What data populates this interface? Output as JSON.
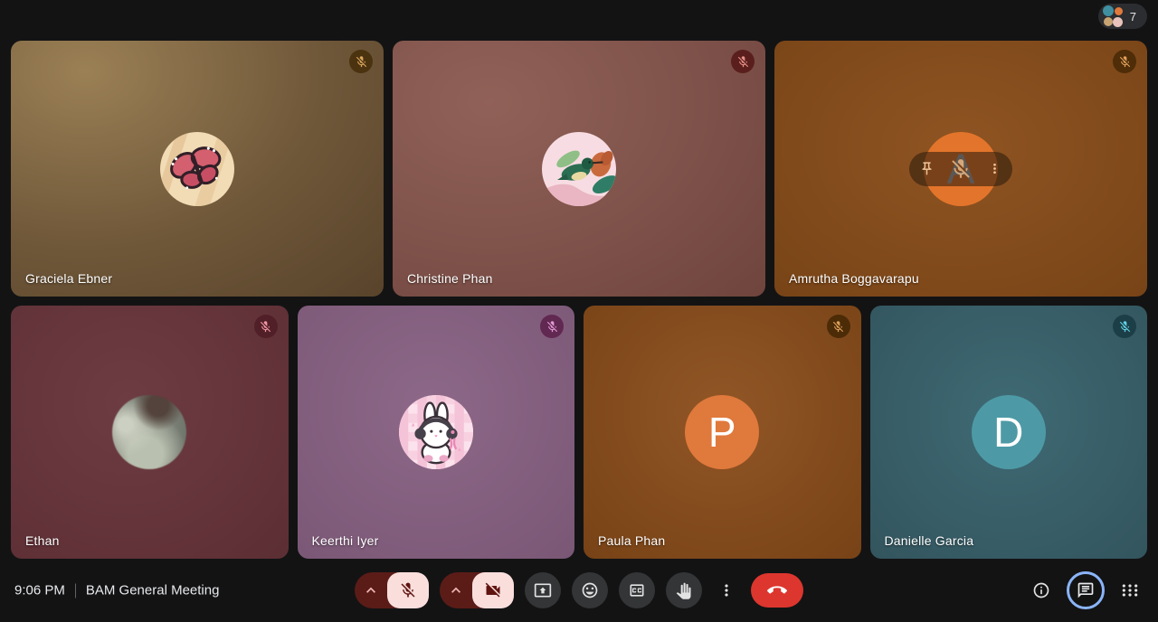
{
  "people_pill": {
    "count": "7"
  },
  "meeting": {
    "time": "9:06 PM",
    "name": "BAM General Meeting"
  },
  "participants": [
    {
      "name": "Graciela Ebner",
      "avatar": "butterfly-image",
      "avatar_bg": "#f2dcb6",
      "tile_colors": [
        "#9b8055",
        "#6f5739",
        "#58432b"
      ],
      "tile_light": "20% 12%",
      "badge_bg": "#4b3310",
      "badge_icon": "#dca75f",
      "mic": "muted"
    },
    {
      "name": "Christine Phan",
      "avatar": "hummingbird-image",
      "avatar_bg": "#f7dde3",
      "tile_colors": [
        "#906158",
        "#7c5048",
        "#6a4038"
      ],
      "tile_light": "26% 24%",
      "badge_bg": "#5a1f1c",
      "badge_icon": "#ea9089",
      "mic": "muted"
    },
    {
      "name": "Amrutha Boggavarapu",
      "avatar": "letter",
      "avatar_letter": "A",
      "avatar_letter_color": "#98abbd",
      "avatar_bg": "#e2752b",
      "tile_colors": [
        "#8f5422",
        "#7b4618",
        "#693a11"
      ],
      "tile_light": "50% 42%",
      "badge_bg": "#4e2d08",
      "badge_icon": "#e2a35e",
      "mic": "muted",
      "hover_controls": true
    },
    {
      "name": "Ethan",
      "avatar": "photo",
      "tile_colors": [
        "#6d3c42",
        "#603137",
        "#532a30"
      ],
      "tile_light": "42% 38%",
      "badge_bg": "#511f28",
      "badge_icon": "#ef97a3",
      "mic": "muted"
    },
    {
      "name": "Keerthi Iyer",
      "avatar": "bunny-image",
      "avatar_bg": "#fbe2ec",
      "tile_colors": [
        "#8d6888",
        "#7e5a79",
        "#6d4c69"
      ],
      "tile_light": "48% 40%",
      "badge_bg": "#612852",
      "badge_icon": "#e39ad5",
      "mic": "muted"
    },
    {
      "name": "Paula Phan",
      "avatar": "letter",
      "avatar_letter": "P",
      "avatar_letter_color": "#ffffff",
      "avatar_bg": "#e0793c",
      "tile_colors": [
        "#915626",
        "#7b4518",
        "#643610"
      ],
      "tile_light": "50% 42%",
      "badge_bg": "#4c2b07",
      "badge_icon": "#dda15a",
      "mic": "muted"
    },
    {
      "name": "Danielle Garcia",
      "avatar": "letter",
      "avatar_letter": "D",
      "avatar_letter_color": "#ffffff",
      "avatar_bg": "#4d9aa6",
      "tile_colors": [
        "#3f6a74",
        "#345760",
        "#2b4a52"
      ],
      "tile_light": "50% 44%",
      "badge_bg": "#1c3e47",
      "badge_icon": "#62d2e8",
      "mic": "muted"
    }
  ],
  "controls": {
    "mic_state": "muted",
    "camera_state": "off",
    "chat_active": true
  },
  "icons": {
    "mic_off": "mic-off",
    "videocam_off": "videocam-off",
    "chevron_up": "chevron-up",
    "present": "present-to-all",
    "smiley": "smiley",
    "cc": "closed-captions",
    "hand": "raise-hand",
    "more_vert": "more-vert",
    "call_end": "call-end",
    "info": "info",
    "chat": "chat",
    "apps": "apps-grid",
    "pin": "pin"
  },
  "colors": {
    "background": "#131314",
    "control_circle": "#333537",
    "control_icon": "#e3e3e3",
    "muted_container": "#5b1c17",
    "muted_chip_bg": "#f9dedc",
    "muted_chip_icon": "#5f1410",
    "end_call_bg": "#dc362e",
    "chat_active_ring": "#8ab4f8",
    "people_pill_bg": "#2b2d30"
  }
}
